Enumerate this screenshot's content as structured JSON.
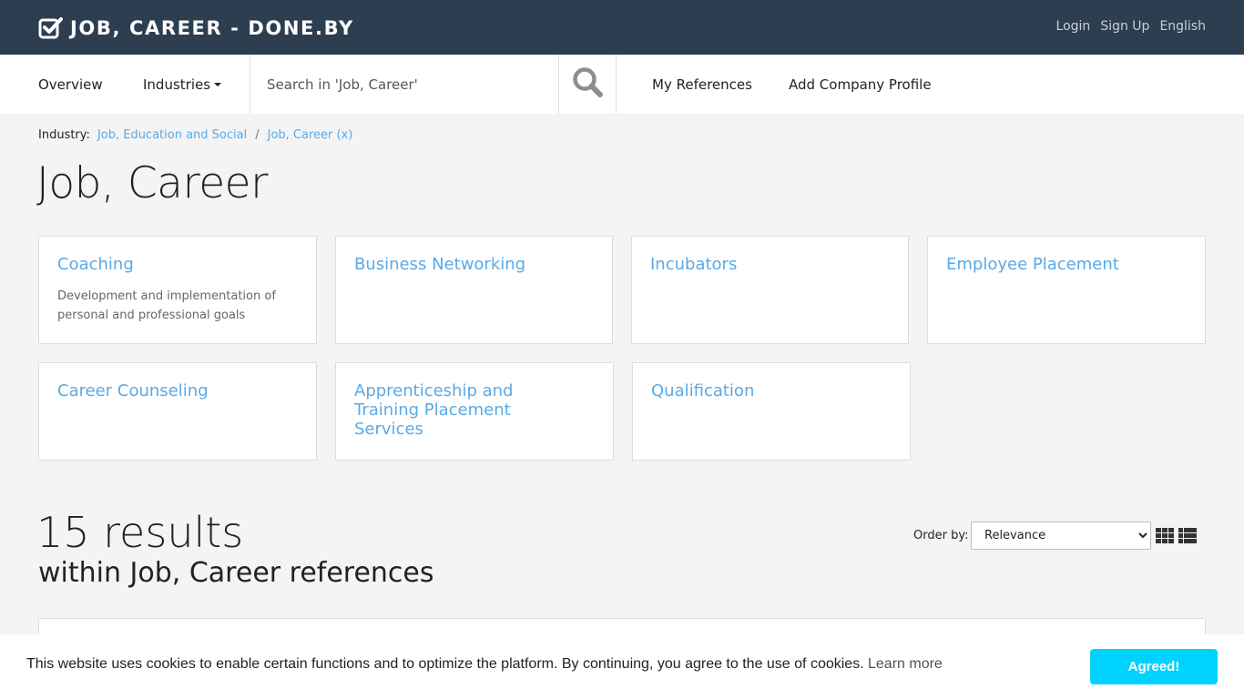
{
  "header": {
    "brand_text": "JOB, CAREER - DONE.BY",
    "login": "Login",
    "signup": "Sign Up",
    "language": "English"
  },
  "nav": {
    "overview": "Overview",
    "industries": "Industries",
    "search_placeholder": "Search in 'Job, Career'",
    "my_references": "My References",
    "add_company_profile": "Add Company Profile"
  },
  "breadcrumb": {
    "label": "Industry:",
    "parent": "Job, Education and Social",
    "separator": "/",
    "current": "Job, Career (x)"
  },
  "page_title": "Job, Career",
  "categories": [
    {
      "title": "Coaching",
      "description": "Development and implementation of personal and professional goals"
    },
    {
      "title": "Business Networking",
      "description": ""
    },
    {
      "title": "Incubators",
      "description": ""
    },
    {
      "title": "Employee Placement",
      "description": ""
    },
    {
      "title": "Career Counseling",
      "description": ""
    },
    {
      "title": "Apprenticeship and Training Placement Services",
      "description": ""
    },
    {
      "title": "Qualification",
      "description": ""
    }
  ],
  "results": {
    "count_text": "15 results",
    "subtitle": "within Job, Career references",
    "order_label": "Order by:",
    "order_selected": "Relevance"
  },
  "cookie": {
    "text": "This website uses cookies to enable certain functions and to optimize the platform. By continuing, you agree to the use of cookies.",
    "learn_more": "Learn more",
    "button": "Agreed!"
  },
  "colors": {
    "topbar": "#2c3e50",
    "link": "#5aa9e6",
    "cookie_button": "#00d2ff"
  }
}
